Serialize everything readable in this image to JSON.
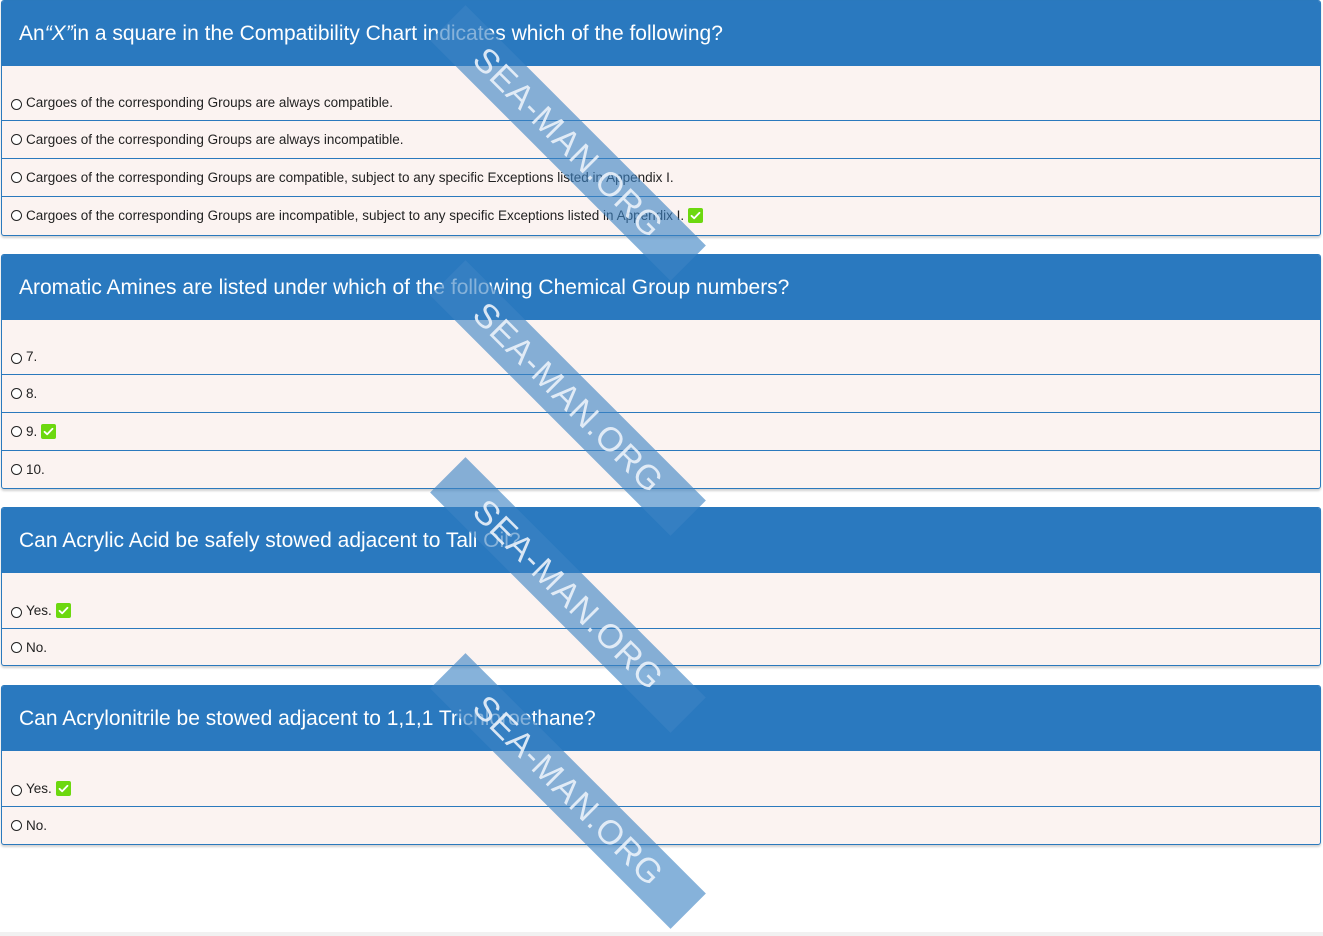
{
  "questions": [
    {
      "title_pre": "An ",
      "title_em": "“X”",
      "title_post": " in a square in the Compatibility Chart indicates which of the following?",
      "options": [
        {
          "label": "Cargoes of the corresponding Groups are always compatible.",
          "correct": false
        },
        {
          "label": "Cargoes of the corresponding Groups are always incompatible.",
          "correct": false
        },
        {
          "label": "Cargoes of the corresponding Groups are compatible, subject to any specific Exceptions listed in Appendix I.",
          "correct": false
        },
        {
          "label": "Cargoes of the corresponding Groups are incompatible, subject to any specific Exceptions listed in Appendix I.",
          "correct": true
        }
      ]
    },
    {
      "title": "Aromatic Amines are listed under which of the following Chemical Group numbers?",
      "options": [
        {
          "label": "7.",
          "correct": false
        },
        {
          "label": "8.",
          "correct": false
        },
        {
          "label": "9.",
          "correct": true
        },
        {
          "label": "10.",
          "correct": false
        }
      ]
    },
    {
      "title": "Can Acrylic Acid be safely stowed adjacent to Tall Oil?",
      "options": [
        {
          "label": "Yes.",
          "correct": true
        },
        {
          "label": "No.",
          "correct": false
        }
      ]
    },
    {
      "title": "Can Acrylonitrile be stowed adjacent to 1,1,1 Trichloroethane?",
      "options": [
        {
          "label": "Yes.",
          "correct": true
        },
        {
          "label": "No.",
          "correct": false
        }
      ]
    }
  ],
  "watermark": "SEA-MAN.ORG",
  "colors": {
    "header": "#2a79bf",
    "card_bg": "#fbf3f1",
    "check": "#6cd80f"
  }
}
